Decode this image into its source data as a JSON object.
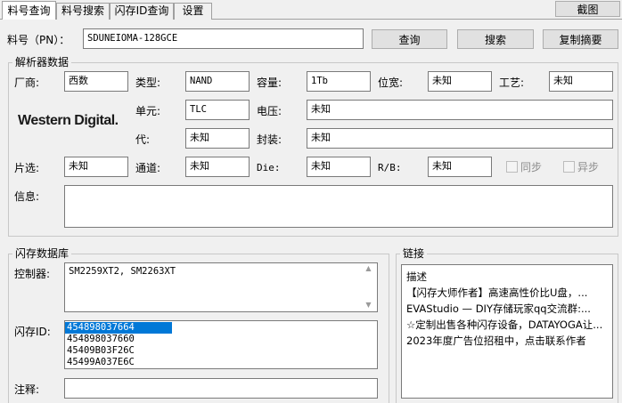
{
  "tabs": [
    "料号查询",
    "料号搜索",
    "闪存ID查询",
    "设置"
  ],
  "screenshot_button": "截图",
  "part_number": {
    "label": "料号（PN）：",
    "value": "SDUNEIOMA-128GCE"
  },
  "actions": {
    "query": "查询",
    "search": "搜索",
    "copy_summary": "复制摘要"
  },
  "parser": {
    "title": "解析器数据",
    "logo_text": "Western Digital.",
    "fields": {
      "vendor": {
        "label": "厂商:",
        "value": "西数"
      },
      "type": {
        "label": "类型:",
        "value": "NAND"
      },
      "capacity": {
        "label": "容量:",
        "value": "1Tb"
      },
      "width": {
        "label": "位宽:",
        "value": "未知"
      },
      "process": {
        "label": "工艺:",
        "value": "未知"
      },
      "cell": {
        "label": "单元:",
        "value": "TLC"
      },
      "voltage": {
        "label": "电压:",
        "value": "未知"
      },
      "generation": {
        "label": "代:",
        "value": "未知"
      },
      "package": {
        "label": "封装:",
        "value": "未知"
      },
      "chip_select": {
        "label": "片选:",
        "value": "未知"
      },
      "channel": {
        "label": "通道:",
        "value": "未知"
      },
      "die": {
        "label": "Die:",
        "value": "未知"
      },
      "rb": {
        "label": "R/B:",
        "value": "未知"
      }
    },
    "sync_label": "同步",
    "async_label": "异步",
    "info_label": "信息:",
    "info_value": ""
  },
  "flash_db": {
    "title": "闪存数据库",
    "controller_label": "控制器:",
    "controller_value": "SM2259XT2, SM2263XT",
    "flash_id_label": "闪存ID:",
    "flash_ids": [
      "454898037664",
      "454898037660",
      "45409B03F26C",
      "45499A037E6C"
    ],
    "note_label": "注释:",
    "note_value": ""
  },
  "links": {
    "title": "链接",
    "header": "描述",
    "items": [
      "【闪存大师作者】高速高性价比U盘，...",
      "EVAStudio — DIY存储玩家qq交流群:...",
      "☆定制出售各种闪存设备，DATAYOGA让...",
      "2023年度广告位招租中，点击联系作者"
    ]
  },
  "colors": {
    "selection": "#0078d7",
    "window_bg": "#f0f0f0",
    "field_border": "#7a7a7a"
  }
}
